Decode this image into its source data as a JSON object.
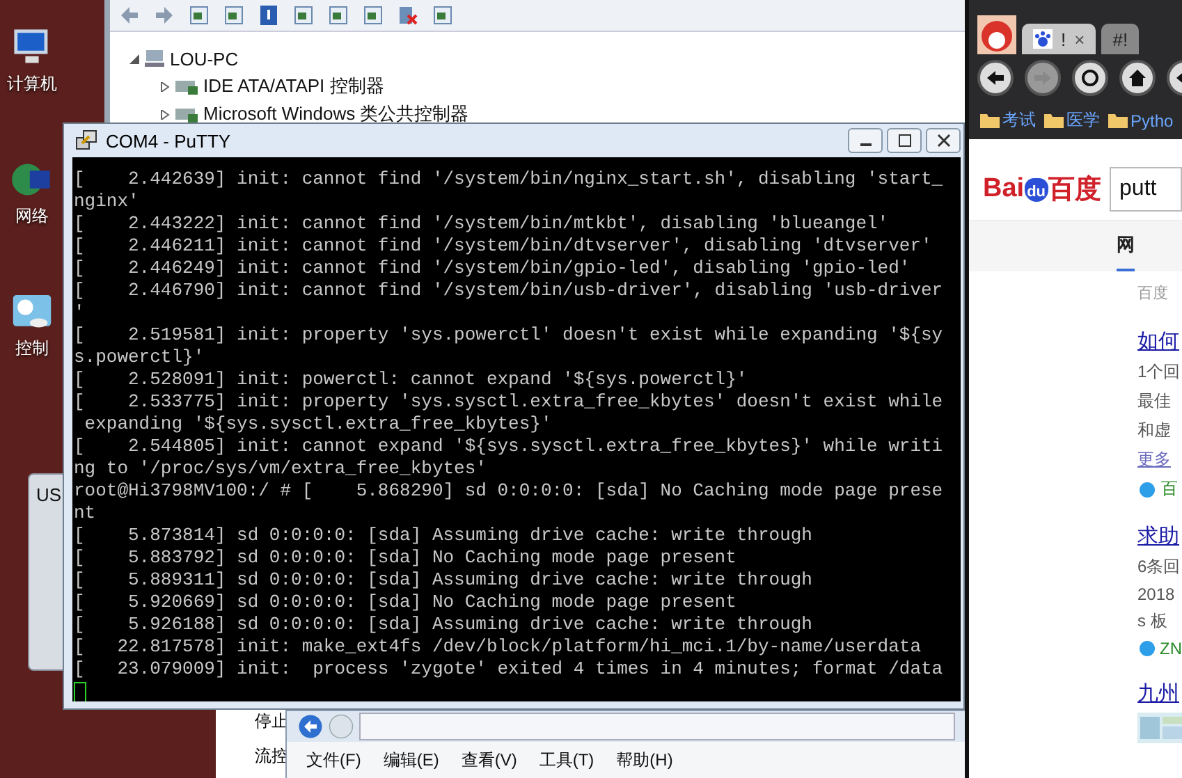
{
  "desktop_icons": [
    {
      "label": "计算机",
      "kind": "computer"
    },
    {
      "label": "网络",
      "kind": "network"
    },
    {
      "label": "控制",
      "kind": "control"
    }
  ],
  "device_manager": {
    "tree": [
      {
        "label": "LOU-PC",
        "expanded": true,
        "children": [
          {
            "label": "IDE ATA/ATAPI 控制器",
            "expanded": false
          },
          {
            "label": "Microsoft Windows 类公共控制器",
            "expanded": false
          }
        ]
      }
    ]
  },
  "usb_window": {
    "title": "US"
  },
  "background_window": {
    "labels": [
      "停止",
      "流控"
    ]
  },
  "putty": {
    "title": "COM4 - PuTTY",
    "lines": [
      "[    2.442639] init: cannot find '/system/bin/nginx_start.sh', disabling 'start_",
      "nginx'",
      "[    2.443222] init: cannot find '/system/bin/mtkbt', disabling 'blueangel'",
      "[    2.446211] init: cannot find '/system/bin/dtvserver', disabling 'dtvserver'",
      "[    2.446249] init: cannot find '/system/bin/gpio-led', disabling 'gpio-led'",
      "[    2.446790] init: cannot find '/system/bin/usb-driver', disabling 'usb-driver",
      "'",
      "[    2.519581] init: property 'sys.powerctl' doesn't exist while expanding '${sy",
      "s.powerctl}'",
      "[    2.528091] init: powerctl: cannot expand '${sys.powerctl}'",
      "[    2.533775] init: property 'sys.sysctl.extra_free_kbytes' doesn't exist while",
      " expanding '${sys.sysctl.extra_free_kbytes}'",
      "[    2.544805] init: cannot expand '${sys.sysctl.extra_free_kbytes}' while writi",
      "ng to '/proc/sys/vm/extra_free_kbytes'",
      "root@Hi3798MV100:/ # [    5.868290] sd 0:0:0:0: [sda] No Caching mode page prese",
      "nt",
      "[    5.873814] sd 0:0:0:0: [sda] Assuming drive cache: write through",
      "[    5.883792] sd 0:0:0:0: [sda] No Caching mode page present",
      "[    5.889311] sd 0:0:0:0: [sda] Assuming drive cache: write through",
      "[    5.920669] sd 0:0:0:0: [sda] No Caching mode page present",
      "[    5.926188] sd 0:0:0:0: [sda] Assuming drive cache: write through",
      "[   22.817578] init: make_ext4fs /dev/block/platform/hi_mci.1/by-name/userdata",
      "[   23.079009] init:  process 'zygote' exited 4 times in 4 minutes; format /data"
    ],
    "cursor": true
  },
  "explorer": {
    "menu": [
      "文件(F)",
      "编辑(E)",
      "查看(V)",
      "工具(T)",
      "帮助(H)"
    ]
  },
  "browser": {
    "tabs": [
      {
        "label": "!",
        "close": "×",
        "selected": true
      },
      {
        "label": "#!",
        "selected": false
      }
    ],
    "nav_buttons": [
      {
        "kind": "back",
        "disabled": false
      },
      {
        "kind": "forward",
        "disabled": true
      },
      {
        "kind": "refresh",
        "disabled": false
      },
      {
        "kind": "home",
        "disabled": false
      },
      {
        "kind": "back",
        "disabled": false
      }
    ],
    "bookmarks": [
      "考试",
      "医学",
      "Pytho"
    ],
    "logo": {
      "left": "Bai",
      "paw": "du",
      "right": "百度"
    },
    "search_value": "putt",
    "nav_tabs": [
      {
        "label": "网",
        "selected": true
      }
    ],
    "result_count": "百度",
    "results": [
      {
        "kind": "text",
        "title": "如何",
        "lines": [
          "1个回",
          "最佳",
          "和虚"
        ],
        "more": "更多",
        "source": "百"
      },
      {
        "kind": "text",
        "title": "求助",
        "lines": [
          "6条回",
          "2018",
          "s 板"
        ],
        "source": "ZN"
      },
      {
        "title": "九州"
      }
    ]
  }
}
